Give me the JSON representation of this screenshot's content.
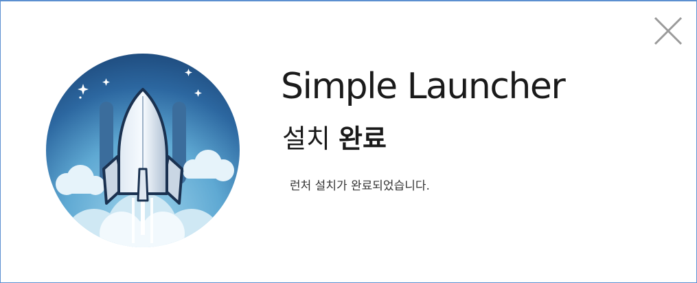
{
  "window": {
    "border_color": "#5b8fd0",
    "close_icon": "close-icon"
  },
  "logo": {
    "icon": "rocket-icon",
    "colors": {
      "sky_dark": "#1f4e82",
      "sky_light": "#8fcbe6",
      "cloud": "#e8f4fa"
    }
  },
  "header": {
    "title": "Simple Launcher",
    "subtitle_regular": "설치",
    "subtitle_bold": "완료"
  },
  "message": "런처 설치가 완료되었습니다."
}
